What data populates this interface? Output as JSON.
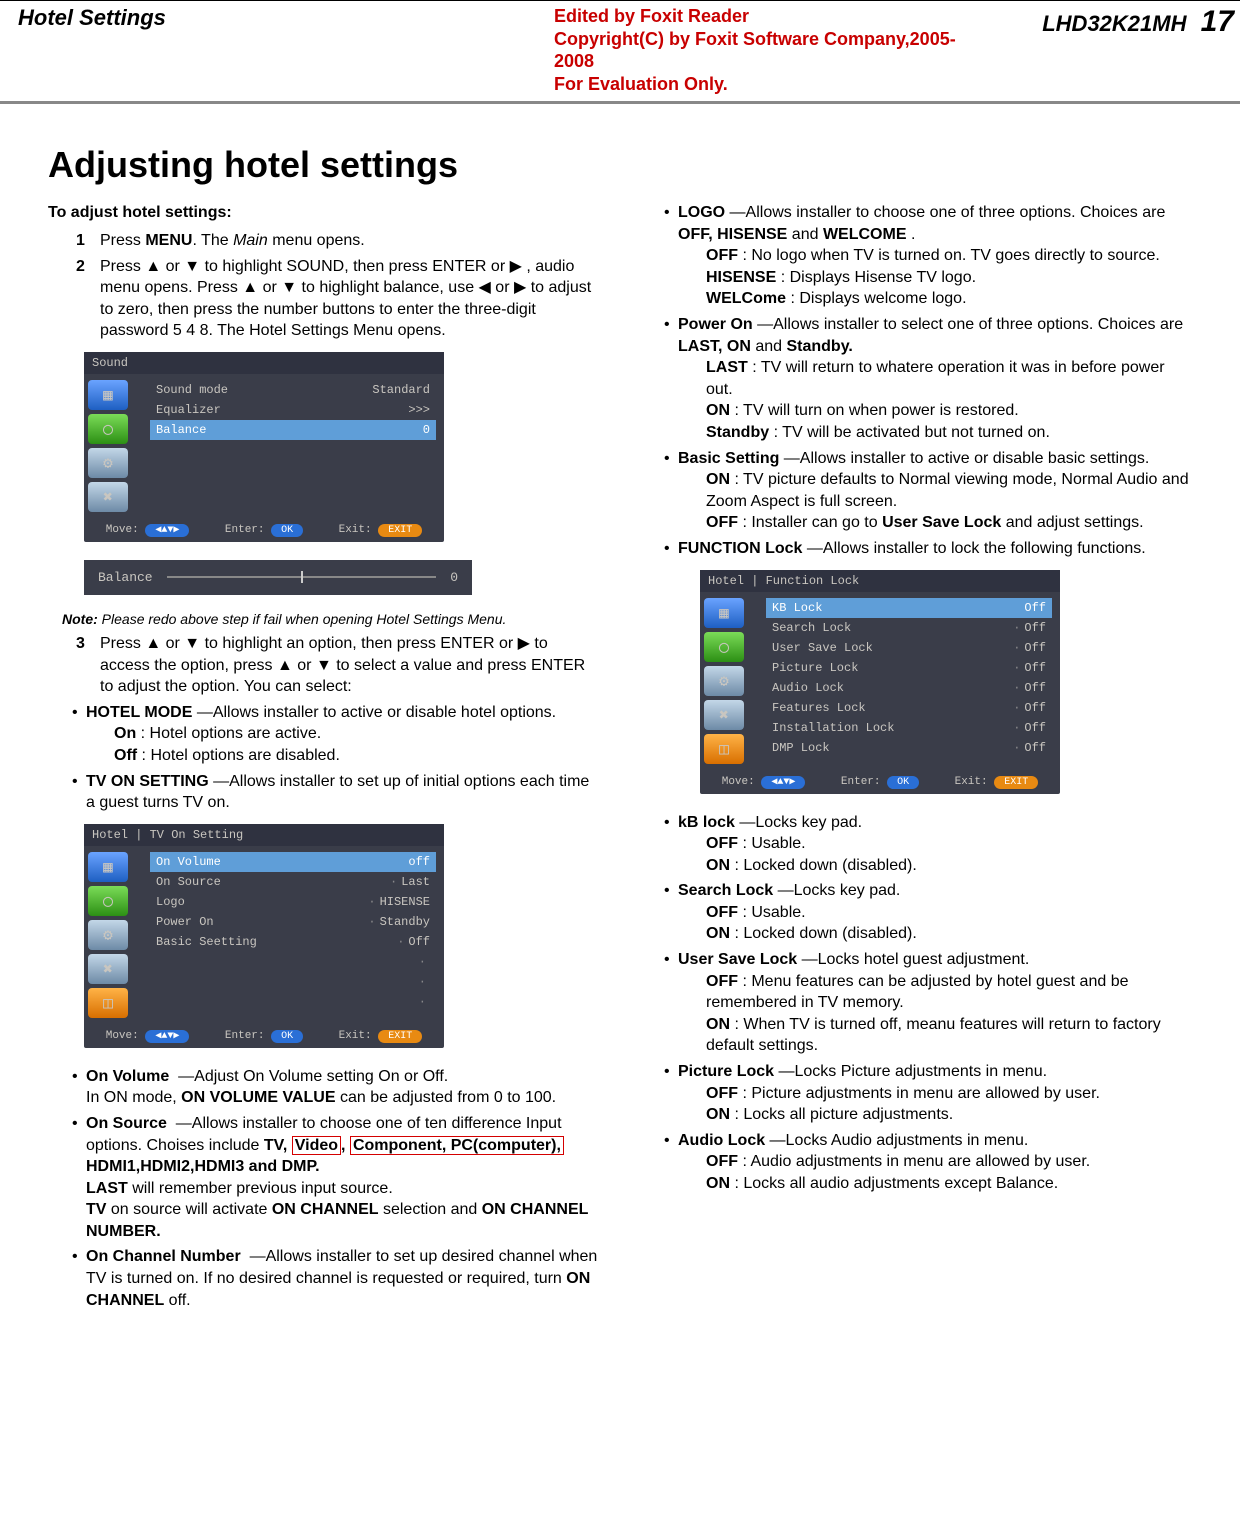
{
  "header": {
    "section": "Hotel Settings",
    "foxit_l1": "Edited by Foxit Reader",
    "foxit_l2": "Copyright(C) by Foxit Software Company,2005-2008",
    "foxit_l3": "For Evaluation Only.",
    "model": "LHD32K21MH",
    "page": "17"
  },
  "h1": "Adjusting hotel settings",
  "left": {
    "intro": "To adjust hotel settings:",
    "step1": "Press MENU. The Main menu opens.",
    "step2": "Press ▲ or ▼ to highlight SOUND, then press ENTER or ▶ , audio menu opens. Press ▲ or ▼ to highlight balance, use ◀ or ▶ to adjust to zero, then press the number buttons to enter the three-digit password 5 4 8. The Hotel Settings Menu opens.",
    "osd1": {
      "tab": "Sound",
      "rows": [
        {
          "l": "Sound mode",
          "r": "Standard"
        },
        {
          "l": "Equalizer",
          "r": ">>>"
        },
        {
          "l": "Balance",
          "r": "0",
          "sel": true
        }
      ],
      "move": "Move:",
      "enter": "Enter:",
      "exit": "Exit:",
      "ok": "OK",
      "exitbtn": "EXIT"
    },
    "slider": {
      "label": "Balance",
      "value": "0"
    },
    "note": "Note: Please redo above step if fail when opening Hotel Settings Menu.",
    "step3": "Press ▲ or ▼ to highlight an option, then press ENTER or ▶ to access the option, press ▲ or ▼ to select a value and press  ENTER to adjust the option. You can select:",
    "hm": "HOTEL MODE —Allows installer to active or disable hotel options.",
    "hm_on": "On : Hotel options are active.",
    "hm_off": "Off : Hotel options are disabled.",
    "tvon": "TV ON SETTING —Allows installer to set up of initial options each time a guest turns TV on.",
    "osd2": {
      "tab": "Hotel | TV On Setting",
      "rows": [
        {
          "l": "On Volume",
          "r": "off",
          "sel": true
        },
        {
          "l": "On Source",
          "r": "Last"
        },
        {
          "l": "Logo",
          "r": "HISENSE"
        },
        {
          "l": "Power On",
          "r": "Standby"
        },
        {
          "l": "Basic Seetting",
          "r": "Off"
        }
      ],
      "move": "Move:",
      "enter": "Enter:",
      "exit": "Exit:",
      "ok": "OK",
      "exitbtn": "EXIT"
    },
    "onvol": "On Volume   —Adjust On Volume setting On or Off.",
    "onvol2": "In ON mode, ON VOLUME VALUE  can be adjusted  from 0 to 100.",
    "onsrc": "On Source   —Allows installer to choose one of ten difference Input options. Choises include TV, Video, Component, PC(computer), HDMI1,HDMI2,HDMI3 and DMP.",
    "onsrc_last": "LAST will remember previous input source.",
    "onsrc_tv": "TV on source will activate  ON CHANNEL selection and ON CHANNEL NUMBER.",
    "onch": "On Channel Number   —Allows installer to set up desired channel when TV is turned on. If no desired channel is requested or required, turn ON CHANNEL off."
  },
  "right": {
    "logo": "LOGO  —Allows installer to choose one of three options. Choices are OFF, HISENSE  and WELCOME  .",
    "logo_off": "OFF : No logo when TV is turned on. TV goes directly to source.",
    "logo_his": "HISENSE : Displays Hisense TV logo.",
    "logo_wel": "WELCome : Displays welcome logo.",
    "power": "Power On —Allows installer to select one of three options. Choices are LAST, ON and Standby.",
    "power_last": "LAST : TV will return to whatere operation it was in before power out.",
    "power_on": "ON : TV will turn on when power is restored.",
    "power_stb": "Standby : TV will be activated but not turned on.",
    "basic": "Basic Setting  —Allows installer to active or disable basic settings.",
    "basic_on": "ON : TV picture defaults to Normal viewing mode, Normal Audio and Zoom Aspect is full screen.",
    "basic_off": "OFF  : Installer can go to User Save Lock   and adjust settings.",
    "flock": "FUNCTION Lock —Allows installer to lock the following functions.",
    "osd3": {
      "tab": "Hotel | Function Lock",
      "rows": [
        {
          "l": "KB Lock",
          "r": "Off",
          "sel": true
        },
        {
          "l": "Search Lock",
          "r": "Off"
        },
        {
          "l": "User Save Lock",
          "r": "Off"
        },
        {
          "l": "Picture Lock",
          "r": "Off"
        },
        {
          "l": "Audio Lock",
          "r": "Off"
        },
        {
          "l": "Features Lock",
          "r": "Off"
        },
        {
          "l": "Installation Lock",
          "r": "Off"
        },
        {
          "l": "DMP Lock",
          "r": "Off"
        }
      ],
      "move": "Move:",
      "enter": "Enter:",
      "exit": "Exit:",
      "ok": "OK",
      "exitbtn": "EXIT"
    },
    "kb": "kB lock —Locks key pad.",
    "kb_off": "OFF : Usable.",
    "kb_on": "ON  : Locked down (disabled).",
    "srch": "Search Lock  —Locks key pad.",
    "srch_off": "OFF : Usable.",
    "srch_on": "ON  : Locked down (disabled).",
    "usl": "User Save Lock —Locks hotel guest adjustment.",
    "usl_off": "OFF : Menu features can be adjusted by hotel guest and be remembered in TV memory.",
    "usl_on": "ON : When TV is turned off, meanu features will return to factory default settings.",
    "pic": "Picture Lock —Locks Picture adjustments in menu.",
    "pic_off": "OFF : Picture adjustments in menu are allowed by user.",
    "pic_on": "ON : Locks all picture adjustments.",
    "aud": "Audio Lock   —Locks Audio adjustments in menu.",
    "aud_off": "OFF : Audio adjustments in menu are allowed by user.",
    "aud_on": "ON : Locks all audio adjustments except Balance."
  }
}
